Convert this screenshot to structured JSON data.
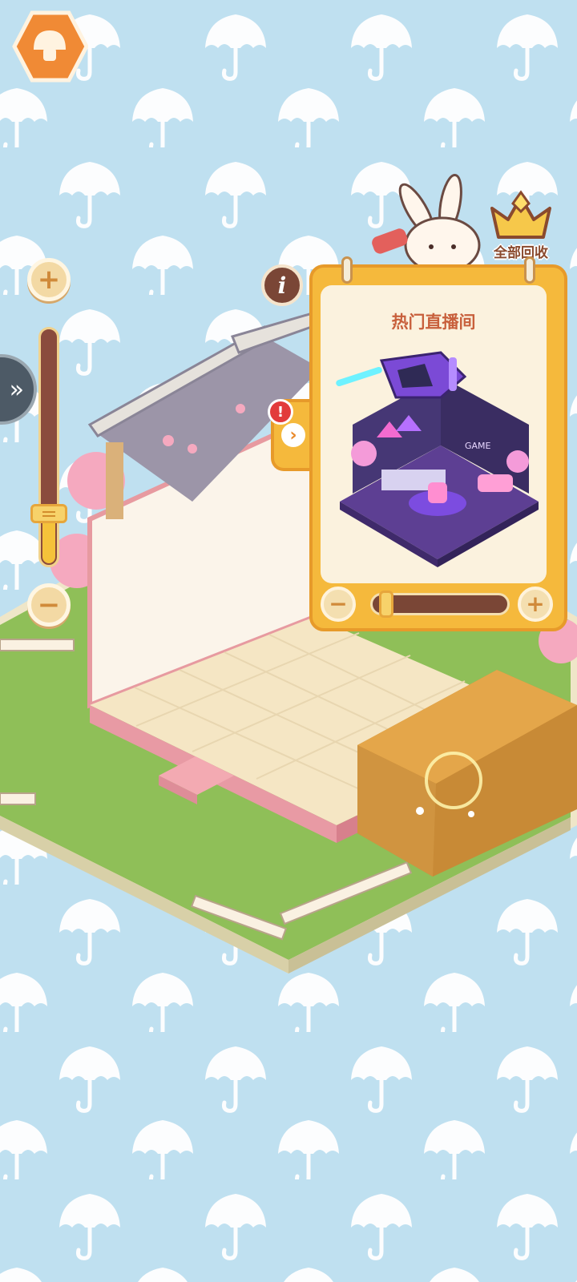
{
  "hud": {
    "home_button_icon": "mushroom-home-icon",
    "recycle_all_label": "全部回收",
    "recycle_icon": "crown-basket-icon",
    "info_icon": "info-icon",
    "side_tab_icon": "double-chevron-right-icon"
  },
  "zoom": {
    "plus_symbol": "+",
    "minus_symbol": "−",
    "level": 0.22
  },
  "room_card": {
    "title": "热门直播间",
    "expand_icon": "chevron-right-icon",
    "alert_badge": "!",
    "size_minus_symbol": "−",
    "size_plus_symbol": "+",
    "size_level": 0.05
  },
  "colors": {
    "sky": "#bfe0f0",
    "accent_orange": "#f5b93c",
    "card_cream": "#fbf2de",
    "title_text": "#c8603c",
    "grass": "#8fbf58"
  }
}
